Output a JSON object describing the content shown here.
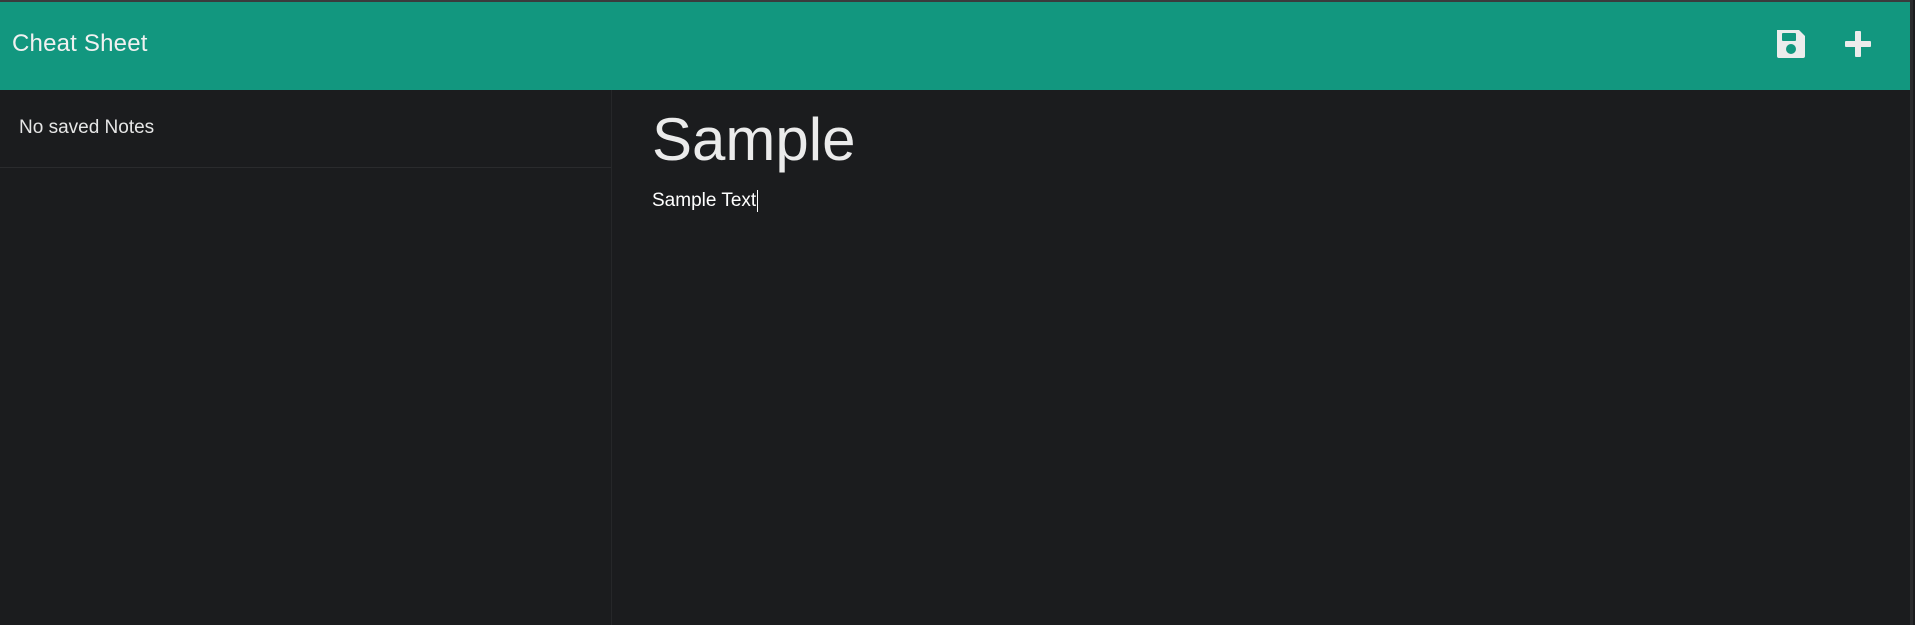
{
  "app": {
    "title": "Cheat Sheet",
    "accent_color": "#12977f"
  },
  "toolbar": {
    "save_icon": "save-icon",
    "add_icon": "plus-icon"
  },
  "sidebar": {
    "empty_message": "No saved Notes"
  },
  "editor": {
    "title": "Sample",
    "text": "Sample Text"
  }
}
